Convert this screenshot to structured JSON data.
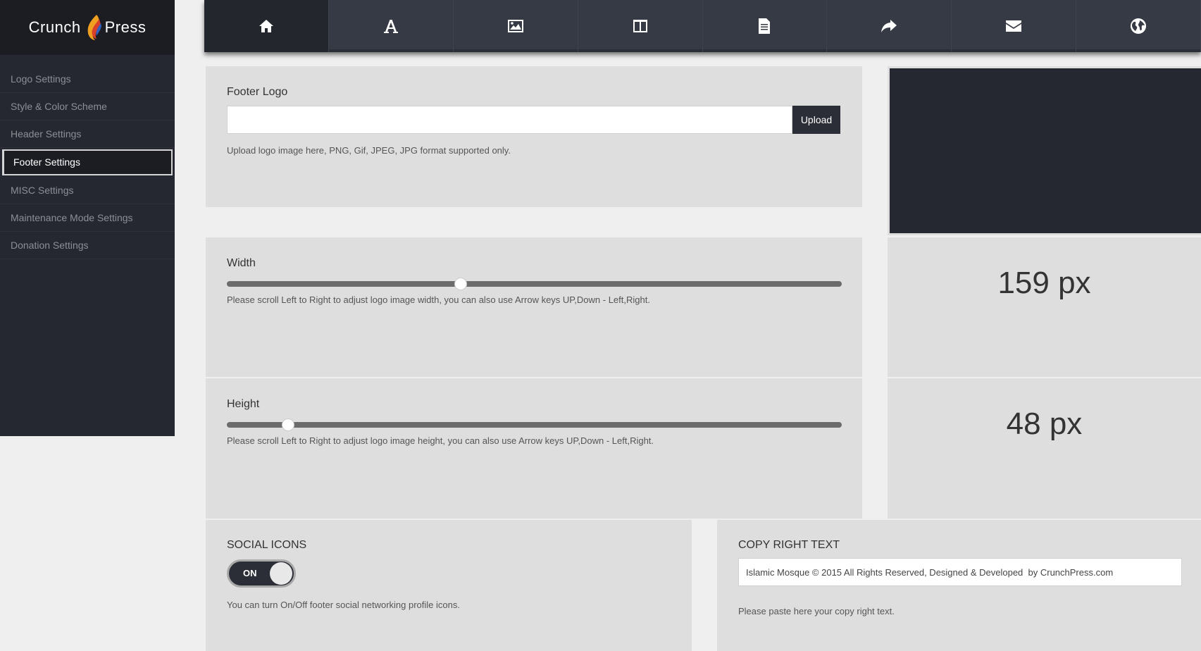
{
  "brand": {
    "left": "Crunch",
    "right": "Press"
  },
  "sidebar": {
    "items": [
      {
        "label": "Logo Settings"
      },
      {
        "label": "Style & Color Scheme"
      },
      {
        "label": "Header Settings"
      },
      {
        "label": "Footer Settings",
        "active": true
      },
      {
        "label": "MISC Settings"
      },
      {
        "label": "Maintenance Mode Settings"
      },
      {
        "label": "Donation Settings"
      }
    ]
  },
  "topnav": {
    "icons": [
      "home-icon",
      "font-icon",
      "image-icon",
      "columns-icon",
      "document-icon",
      "share-icon",
      "envelope-icon",
      "globe-icon"
    ],
    "active_index": 0
  },
  "footer_logo": {
    "title": "Footer Logo",
    "input_value": "",
    "upload_label": "Upload",
    "hint": "Upload logo image here, PNG, Gif, JPEG, JPG format supported only."
  },
  "width": {
    "title": "Width",
    "value_percent": 38,
    "hint": "Please scroll Left to Right to adjust logo image width, you can also use Arrow keys UP,Down - Left,Right.",
    "display": "159 px"
  },
  "height": {
    "title": "Height",
    "value_percent": 10,
    "hint": "Please scroll Left to Right to adjust logo image height, you can also use Arrow keys UP,Down - Left,Right.",
    "display": "48 px"
  },
  "social": {
    "title": "SOCIAL ICONS",
    "toggle_label": "ON",
    "hint": "You can turn On/Off footer social networking profile icons."
  },
  "copyright": {
    "title": "COPY RIGHT TEXT",
    "input_value": "Islamic Mosque © 2015 All Rights Reserved, Designed & Developed  by CrunchPress.com",
    "hint": "Please paste here your copy right text."
  },
  "colors": {
    "sidebar": "#252830",
    "topnav": "#363a44",
    "panel": "#dedede",
    "dark": "#2b2e36"
  }
}
